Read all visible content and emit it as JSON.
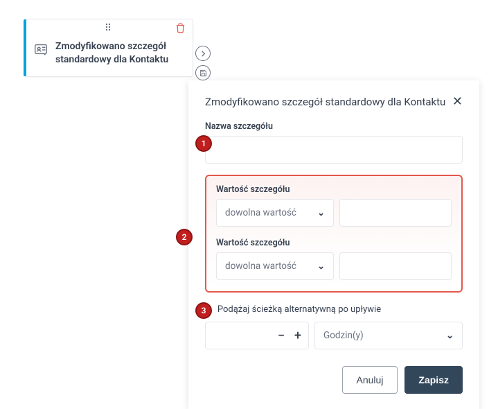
{
  "card": {
    "title": "Zmodyfikowano szczegół standardowy dla Kontaktu"
  },
  "panel": {
    "title": "Zmodyfikowano szczegół standardowy dla Kontaktu",
    "name_label": "Nazwa szczegółu",
    "detail_value_label_1": "Wartość szczegółu",
    "detail_value_label_2": "Wartość szczegółu",
    "any_value_1": "dowolna wartość",
    "any_value_2": "dowolna wartość",
    "alt_path_label": "Podążaj ścieżką alternatywną po upływie",
    "unit": "Godzin(y)",
    "cancel": "Anuluj",
    "save": "Zapisz"
  },
  "badges": {
    "one": "1",
    "two": "2",
    "three": "3"
  }
}
